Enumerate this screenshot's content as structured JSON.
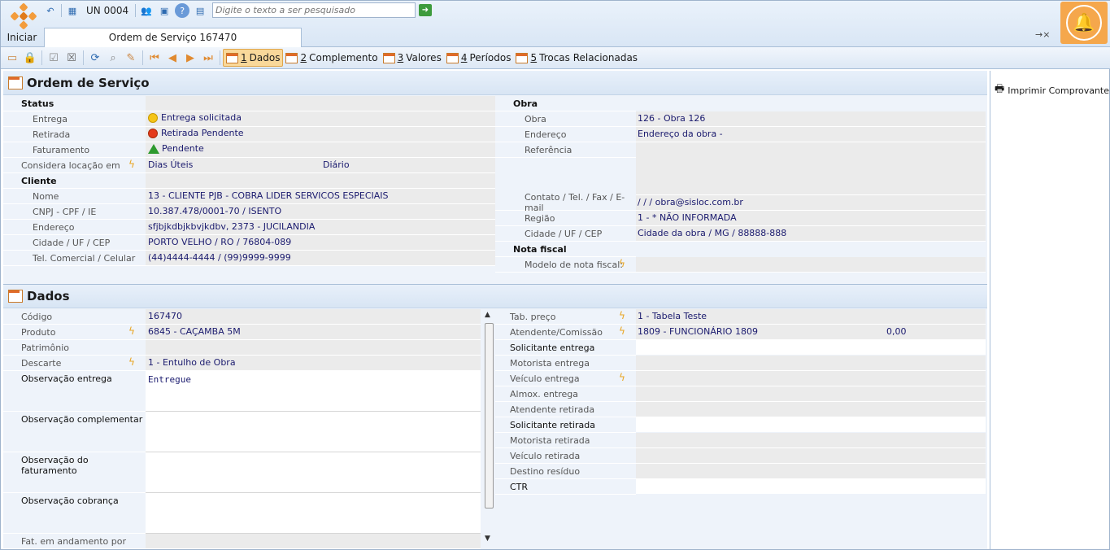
{
  "topbar": {
    "iniciar": "Iniciar",
    "un_label": "UN 0004",
    "search_placeholder": "Digite o texto a ser pesquisado",
    "tab_title": "Ordem de Serviço 167470",
    "tab_close": "→×"
  },
  "toolbar": {
    "tabs": [
      {
        "num": "1",
        "label": " Dados"
      },
      {
        "num": "2",
        "label": " Complemento"
      },
      {
        "num": "3",
        "label": " Valores"
      },
      {
        "num": "4",
        "label": " Períodos"
      },
      {
        "num": "5",
        "label": " Trocas Relacionadas"
      }
    ]
  },
  "right_panel": {
    "print_label": "Imprimir Comprovante de"
  },
  "ordem": {
    "title": "Ordem de Serviço",
    "status_header": "Status",
    "entrega_label": "Entrega",
    "entrega_value": "Entrega solicitada",
    "retirada_label": "Retirada",
    "retirada_value": "Retirada Pendente",
    "faturamento_label": "Faturamento",
    "faturamento_value": "Pendente",
    "considera_label": "Considera locação em",
    "considera_value": "Dias Úteis",
    "considera_value2": "Diário",
    "cliente_header": "Cliente",
    "nome_label": "Nome",
    "nome_value": "13 - CLIENTE PJB - COBRA LIDER SERVICOS ESPECIAIS",
    "cnpj_label": "CNPJ - CPF / IE",
    "cnpj_value": "10.387.478/0001-70 / ISENTO",
    "endereco_label": "Endereço",
    "endereco_value": "sfjbjkdbjkbvjkdbv, 2373 - JUCILANDIA",
    "cidade_label": "Cidade / UF / CEP",
    "cidade_value": "PORTO VELHO / RO / 76804-089",
    "tel_label": "Tel. Comercial / Celular",
    "tel_value": "(44)4444-4444 / (99)9999-9999",
    "obra_header": "Obra",
    "obra_label": "Obra",
    "obra_value": "126 - Obra 126",
    "obra_end_label": "Endereço",
    "obra_end_value": "Endereço da obra -",
    "referencia_label": "Referência",
    "contato_label": "Contato / Tel. / Fax / E-mail",
    "contato_value": "/  /  / obra@sisloc.com.br",
    "regiao_label": "Região",
    "regiao_value": "1 - * NÃO INFORMADA",
    "obra_cidade_label": "Cidade / UF / CEP",
    "obra_cidade_value": "Cidade da obra / MG / 88888-888",
    "nota_header": "Nota fiscal",
    "modelo_label": "Modelo de nota fiscal:"
  },
  "dados": {
    "title": "Dados",
    "codigo_label": "Código",
    "codigo_value": "167470",
    "produto_label": "Produto",
    "produto_value": "6845 - CAÇAMBA 5M",
    "patrimonio_label": "Patrimônio",
    "descarte_label": "Descarte",
    "descarte_value": "1 - Entulho de Obra",
    "obs_entrega_label": "Observação entrega",
    "obs_entrega_value": "Entregue",
    "obs_compl_label": "Observação complementar",
    "obs_fat_label": "Observação do faturamento",
    "obs_cobr_label": "Observação cobrança",
    "fat_andamento_label": "Fat. em andamento por",
    "tab_preco_label": "Tab. preço",
    "tab_preco_value": "1 - Tabela Teste",
    "atendente_label": "Atendente/Comissão",
    "atendente_value": "1809 - FUNCIONÁRIO  1809",
    "atendente_comissao": "0,00",
    "solic_entrega_label": "Solicitante entrega",
    "motorista_entrega_label": "Motorista entrega",
    "veiculo_entrega_label": "Veículo entrega",
    "almox_label": "Almox. entrega",
    "atendente_ret_label": "Atendente retirada",
    "solic_ret_label": "Solicitante retirada",
    "motorista_ret_label": "Motorista retirada",
    "veiculo_ret_label": "Veículo retirada",
    "destino_label": "Destino resíduo",
    "ctr_label": "CTR"
  },
  "colors": {
    "accent": "#f39c3c",
    "label": "#555555",
    "value": "#1a1a6e",
    "header_bg": "#d8e5f4"
  }
}
